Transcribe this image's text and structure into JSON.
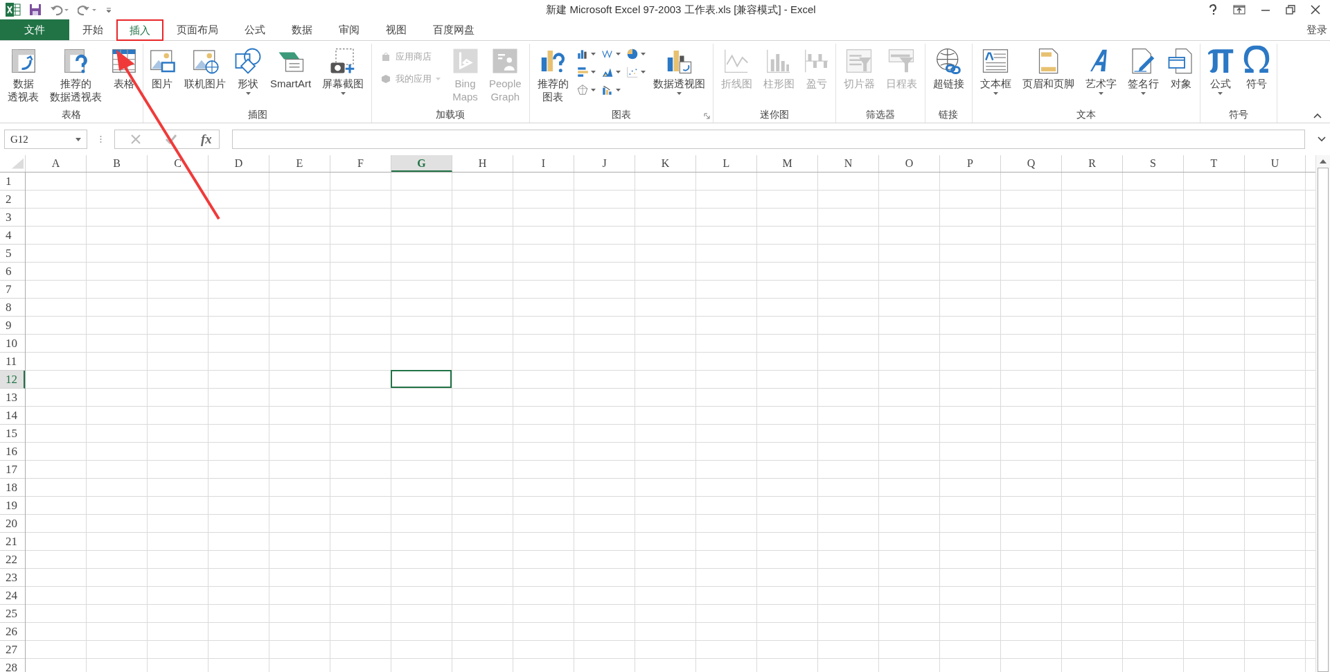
{
  "title_bar": {
    "title": "新建 Microsoft Excel 97-2003 工作表.xls  [兼容模式] - Excel"
  },
  "tabs": [
    {
      "label": "文件",
      "kind": "file",
      "selected": false,
      "annotated": false
    },
    {
      "label": "开始",
      "kind": "tab",
      "selected": false,
      "annotated": false
    },
    {
      "label": "插入",
      "kind": "tab",
      "selected": true,
      "annotated": true
    },
    {
      "label": "页面布局",
      "kind": "tab",
      "selected": false,
      "annotated": false
    },
    {
      "label": "公式",
      "kind": "tab",
      "selected": false,
      "annotated": false
    },
    {
      "label": "数据",
      "kind": "tab",
      "selected": false,
      "annotated": false
    },
    {
      "label": "审阅",
      "kind": "tab",
      "selected": false,
      "annotated": false
    },
    {
      "label": "视图",
      "kind": "tab",
      "selected": false,
      "annotated": false
    },
    {
      "label": "百度网盘",
      "kind": "tab",
      "selected": false,
      "annotated": false
    }
  ],
  "account": {
    "label": "登录"
  },
  "pointer_arrow": true,
  "ribbon": {
    "groups": [
      {
        "label": "表格",
        "items": [
          {
            "kind": "large",
            "lines": [
              "数据",
              "透视表"
            ],
            "disabled": false,
            "dropdown": false
          },
          {
            "kind": "large",
            "lines": [
              "推荐的",
              "数据透视表"
            ],
            "disabled": false,
            "dropdown": false
          },
          {
            "kind": "large",
            "lines": [
              "表格"
            ],
            "disabled": false,
            "dropdown": false
          }
        ]
      },
      {
        "label": "插图",
        "items": [
          {
            "kind": "large",
            "lines": [
              "图片"
            ],
            "disabled": false,
            "dropdown": false
          },
          {
            "kind": "large",
            "lines": [
              "联机图片"
            ],
            "disabled": false,
            "dropdown": false
          },
          {
            "kind": "large",
            "lines": [
              "形状"
            ],
            "disabled": false,
            "dropdown": true
          },
          {
            "kind": "large",
            "lines": [
              "SmartArt"
            ],
            "disabled": false,
            "dropdown": false
          },
          {
            "kind": "large",
            "lines": [
              "屏幕截图"
            ],
            "disabled": false,
            "dropdown": true
          }
        ]
      },
      {
        "label": "加载项",
        "items": [
          {
            "kind": "stack",
            "items": [
              {
                "label": "应用商店",
                "disabled": true,
                "dropdown": false
              },
              {
                "label": "我的应用",
                "disabled": true,
                "dropdown": true
              }
            ]
          },
          {
            "kind": "large",
            "lines": [
              "Bing",
              "Maps"
            ],
            "disabled": true,
            "dropdown": false
          },
          {
            "kind": "large",
            "lines": [
              "People",
              "Graph"
            ],
            "disabled": true,
            "dropdown": false
          }
        ]
      },
      {
        "label": "图表",
        "launcher": true,
        "items": [
          {
            "kind": "large",
            "lines": [
              "推荐的",
              "图表"
            ],
            "disabled": false,
            "dropdown": false
          },
          {
            "kind": "chart-grid"
          },
          {
            "kind": "large",
            "lines": [
              "数据透视图"
            ],
            "disabled": false,
            "dropdown": true
          }
        ]
      },
      {
        "label": "迷你图",
        "items": [
          {
            "kind": "large",
            "lines": [
              "折线图"
            ],
            "disabled": true,
            "dropdown": false
          },
          {
            "kind": "large",
            "lines": [
              "柱形图"
            ],
            "disabled": true,
            "dropdown": false
          },
          {
            "kind": "large",
            "lines": [
              "盈亏"
            ],
            "disabled": true,
            "dropdown": false
          }
        ]
      },
      {
        "label": "筛选器",
        "items": [
          {
            "kind": "large",
            "lines": [
              "切片器"
            ],
            "disabled": true,
            "dropdown": false
          },
          {
            "kind": "large",
            "lines": [
              "日程表"
            ],
            "disabled": true,
            "dropdown": false
          }
        ]
      },
      {
        "label": "链接",
        "items": [
          {
            "kind": "large",
            "lines": [
              "超链接"
            ],
            "disabled": false,
            "dropdown": false
          }
        ]
      },
      {
        "label": "文本",
        "items": [
          {
            "kind": "large",
            "lines": [
              "文本框"
            ],
            "disabled": false,
            "dropdown": true
          },
          {
            "kind": "large",
            "lines": [
              "页眉和页脚"
            ],
            "disabled": false,
            "dropdown": false
          },
          {
            "kind": "large",
            "lines": [
              "艺术字"
            ],
            "disabled": false,
            "dropdown": true
          },
          {
            "kind": "large",
            "lines": [
              "签名行"
            ],
            "disabled": false,
            "dropdown": true
          },
          {
            "kind": "large",
            "lines": [
              "对象"
            ],
            "disabled": false,
            "dropdown": false
          }
        ]
      },
      {
        "label": "符号",
        "items": [
          {
            "kind": "large",
            "lines": [
              "公式"
            ],
            "disabled": false,
            "dropdown": true
          },
          {
            "kind": "large",
            "lines": [
              "符号"
            ],
            "disabled": false,
            "dropdown": false
          }
        ]
      }
    ]
  },
  "formula_bar": {
    "name_box": "G12",
    "function_label": "fx"
  },
  "sheet": {
    "columns": [
      {
        "label": "A",
        "selected": false
      },
      {
        "label": "B",
        "selected": false
      },
      {
        "label": "C",
        "selected": false
      },
      {
        "label": "D",
        "selected": false
      },
      {
        "label": "E",
        "selected": false
      },
      {
        "label": "F",
        "selected": false
      },
      {
        "label": "G",
        "selected": true
      },
      {
        "label": "H",
        "selected": false
      },
      {
        "label": "I",
        "selected": false
      },
      {
        "label": "J",
        "selected": false
      },
      {
        "label": "K",
        "selected": false
      },
      {
        "label": "L",
        "selected": false
      },
      {
        "label": "M",
        "selected": false
      },
      {
        "label": "N",
        "selected": false
      },
      {
        "label": "O",
        "selected": false
      },
      {
        "label": "P",
        "selected": false
      },
      {
        "label": "Q",
        "selected": false
      },
      {
        "label": "R",
        "selected": false
      },
      {
        "label": "S",
        "selected": false
      },
      {
        "label": "T",
        "selected": false
      },
      {
        "label": "U",
        "selected": false
      }
    ],
    "rows": [
      {
        "label": "1",
        "selected": false
      },
      {
        "label": "2",
        "selected": false
      },
      {
        "label": "3",
        "selected": false
      },
      {
        "label": "4",
        "selected": false
      },
      {
        "label": "5",
        "selected": false
      },
      {
        "label": "6",
        "selected": false
      },
      {
        "label": "7",
        "selected": false
      },
      {
        "label": "8",
        "selected": false
      },
      {
        "label": "9",
        "selected": false
      },
      {
        "label": "10",
        "selected": false
      },
      {
        "label": "11",
        "selected": false
      },
      {
        "label": "12",
        "selected": true
      },
      {
        "label": "13",
        "selected": false
      },
      {
        "label": "14",
        "selected": false
      },
      {
        "label": "15",
        "selected": false
      },
      {
        "label": "16",
        "selected": false
      },
      {
        "label": "17",
        "selected": false
      },
      {
        "label": "18",
        "selected": false
      },
      {
        "label": "19",
        "selected": false
      },
      {
        "label": "20",
        "selected": false
      },
      {
        "label": "21",
        "selected": false
      },
      {
        "label": "22",
        "selected": false
      },
      {
        "label": "23",
        "selected": false
      },
      {
        "label": "24",
        "selected": false
      },
      {
        "label": "25",
        "selected": false
      },
      {
        "label": "26",
        "selected": false
      },
      {
        "label": "27",
        "selected": false
      },
      {
        "label": "28",
        "selected": false
      }
    ]
  }
}
